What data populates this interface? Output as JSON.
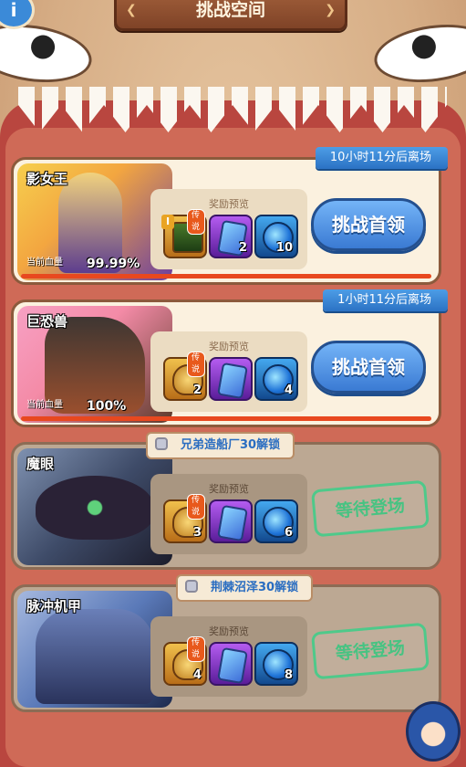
{
  "header": {
    "title": "挑战空间",
    "info_label": "i"
  },
  "bosses": [
    {
      "name": "影女王",
      "hp_label": "当前血量",
      "hp_value": "99.99%",
      "hp_fraction": 0.9999,
      "timer": "10小时11分后离场",
      "reward_title": "奖励预览",
      "items": {
        "gold_qty": "",
        "gold_tier": "I",
        "legend": "传说",
        "purple_qty": "2",
        "blue_qty": "10"
      },
      "action_label": "挑战首领",
      "portrait_colors": [
        "#f6cf4e",
        "#6b3fa0"
      ]
    },
    {
      "name": "巨恐兽",
      "hp_label": "当前血量",
      "hp_value": "100%",
      "hp_fraction": 1.0,
      "timer": "1小时11分后离场",
      "reward_title": "奖励预览",
      "items": {
        "gold_qty": "2",
        "legend": "传说",
        "purple_qty": "",
        "blue_qty": "4"
      },
      "action_label": "挑战首领",
      "portrait_colors": [
        "#f7a1c4",
        "#5b3a2a"
      ]
    },
    {
      "name": "魔眼",
      "lock_text": "兄弟造船厂30解锁",
      "reward_title": "奖励预览",
      "items": {
        "gold_qty": "3",
        "legend": "传说",
        "purple_qty": "",
        "blue_qty": "6"
      },
      "status_label": "等待登场",
      "portrait_colors": [
        "#3e4b68",
        "#1c1c2b"
      ]
    },
    {
      "name": "脉冲机甲",
      "lock_text": "荆棘沼泽30解锁",
      "reward_title": "奖励预览",
      "items": {
        "gold_qty": "4",
        "legend": "传说",
        "purple_qty": "",
        "blue_qty": "8"
      },
      "status_label": "等待登场",
      "portrait_colors": [
        "#5a79b8",
        "#1d2a4e"
      ]
    }
  ],
  "colors": {
    "accent_blue": "#3a7ad3",
    "hp_fill": "#e8481f",
    "wait_green": "#47c382"
  }
}
